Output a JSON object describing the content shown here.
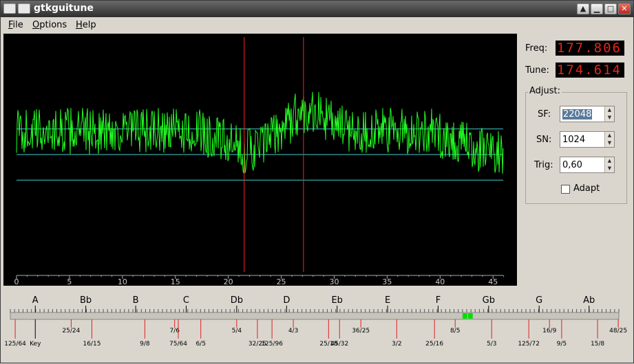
{
  "window": {
    "title": "gtkguitune"
  },
  "menu": {
    "file": "File",
    "options": "Options",
    "help": "Help"
  },
  "readouts": {
    "freq_label": "Freq:",
    "freq_value": "177.806",
    "tune_label": "Tune:",
    "tune_value": "174.614"
  },
  "adjust": {
    "title": "Adjust:",
    "sf_label": "SF:",
    "sf_value": "22048",
    "sn_label": "SN:",
    "sn_value": "1024",
    "trig_label": "Trig:",
    "trig_value": "0,60",
    "adapt_label": "Adapt",
    "adapt_checked": false
  },
  "colors": {
    "signal": "#22ff22",
    "trigger_lines": "#40d0d0",
    "markers": "#ff2222",
    "scope_bg": "#000000",
    "lcd_text": "#e82418"
  },
  "chart_data": {
    "type": "line",
    "x_range": [
      0,
      47
    ],
    "x_ticks": [
      "0",
      "5",
      "10",
      "15",
      "20",
      "25",
      "30",
      "35",
      "40",
      "45"
    ],
    "trigger_levels": [
      0.6,
      0,
      -0.6
    ],
    "marker_x": [
      21.5,
      27.1
    ],
    "signal_seed": 1337
  },
  "tuner_scale": {
    "notes": [
      "A",
      "Bb",
      "B",
      "C",
      "Db",
      "D",
      "Eb",
      "E",
      "F",
      "Gb",
      "G",
      "Ab"
    ],
    "notes_pos": [
      0.041,
      0.124,
      0.206,
      0.289,
      0.372,
      0.454,
      0.537,
      0.62,
      0.703,
      0.786,
      0.869,
      0.951
    ],
    "ratios": [
      {
        "label": "125/64",
        "pos": 0.008,
        "row": 1
      },
      {
        "label": "Key",
        "pos": 0.041,
        "row": 1,
        "black": true
      },
      {
        "label": "25/24",
        "pos": 0.1,
        "row": 0
      },
      {
        "label": "16/15",
        "pos": 0.134,
        "row": 1
      },
      {
        "label": "9/8",
        "pos": 0.221,
        "row": 1
      },
      {
        "label": "7/6",
        "pos": 0.27,
        "row": 0
      },
      {
        "label": "75/64",
        "pos": 0.276,
        "row": 1
      },
      {
        "label": "6/5",
        "pos": 0.313,
        "row": 1
      },
      {
        "label": "5/4",
        "pos": 0.372,
        "row": 0
      },
      {
        "label": "32/25",
        "pos": 0.406,
        "row": 1
      },
      {
        "label": "125/96",
        "pos": 0.43,
        "row": 1
      },
      {
        "label": "4/3",
        "pos": 0.465,
        "row": 0
      },
      {
        "label": "25/18",
        "pos": 0.523,
        "row": 1
      },
      {
        "label": "45/32",
        "pos": 0.541,
        "row": 1
      },
      {
        "label": "36/25",
        "pos": 0.576,
        "row": 0
      },
      {
        "label": "3/2",
        "pos": 0.635,
        "row": 1
      },
      {
        "label": "25/16",
        "pos": 0.697,
        "row": 1
      },
      {
        "label": "8/5",
        "pos": 0.731,
        "row": 0
      },
      {
        "label": "5/3",
        "pos": 0.791,
        "row": 1
      },
      {
        "label": "125/72",
        "pos": 0.852,
        "row": 1
      },
      {
        "label": "16/9",
        "pos": 0.886,
        "row": 0
      },
      {
        "label": "9/5",
        "pos": 0.906,
        "row": 1
      },
      {
        "label": "15/8",
        "pos": 0.965,
        "row": 1
      },
      {
        "label": "48/25",
        "pos": 0.999,
        "row": 0
      }
    ],
    "indicator_pos": 0.752
  }
}
